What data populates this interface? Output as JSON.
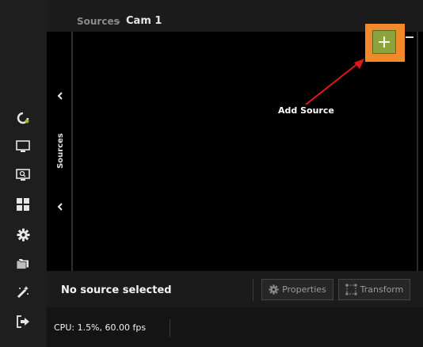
{
  "header": {
    "breadcrumb_parent": "Sources",
    "breadcrumb_separator": "-",
    "breadcrumb_current": "Cam 1"
  },
  "left_rail": {
    "icons": [
      "loader-icon",
      "monitor-icon",
      "screen-search-icon",
      "grid-icon",
      "gear-icon",
      "folders-icon",
      "magic-wand-icon",
      "exit-icon"
    ]
  },
  "sources_panel": {
    "tab_label": "Sources",
    "add_label": "+",
    "remove_label": "−"
  },
  "callout": {
    "label": "Add Source",
    "highlight_color": "#f08a2c",
    "arrow_color": "#e01818"
  },
  "bottom_bar": {
    "selection_text": "No source selected",
    "properties_label": "Properties",
    "transform_label": "Transform"
  },
  "status_bar": {
    "cpu_text": "CPU: 1.5%, 60.00 fps"
  },
  "colors": {
    "accent_green": "#8da33d",
    "background": "#000000"
  }
}
